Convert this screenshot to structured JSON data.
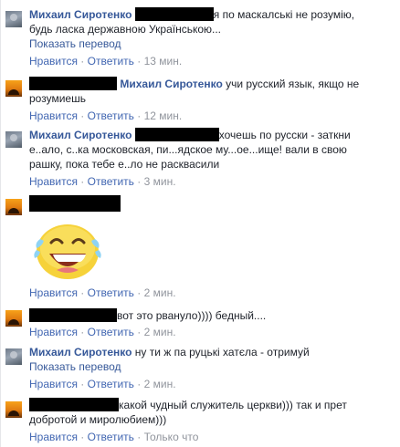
{
  "comments": [
    {
      "author": "Михаил Сиротенко",
      "line1": "я по маскалські не розумію,",
      "line2": "будь ласка державною Українською...",
      "see_translation": "Показать перевод",
      "like": "Нравится",
      "reply": "Ответить",
      "dot": "·",
      "time": "13 мин."
    },
    {
      "author": "Михаил Сиротенко",
      "line1": "учи русский язык, якщо не",
      "line2": "розумиешь",
      "like": "Нравится",
      "reply": "Ответить",
      "dot": "·",
      "time": "12 мин."
    },
    {
      "author": "Михаил Сиротенко",
      "line1": "хочешь по русски - заткни",
      "line2": "е..ало, с..ка московская, пи...ядское му...ое...ище! вали в свою",
      "line3": "рашку, пока тебе е..ло не расквасили",
      "like": "Нравится",
      "reply": "Ответить",
      "dot": "·",
      "time": "3 мин."
    },
    {
      "like": "Нравится",
      "reply": "Ответить",
      "dot": "·",
      "time": "2 мин."
    },
    {
      "line1": "вот это рвануло)))) бедный....",
      "like": "Нравится",
      "reply": "Ответить",
      "dot": "·",
      "time": "2 мин."
    },
    {
      "author": "Михаил Сиротенко",
      "line1": "ну ти ж па руцькі хатєла - отримуй",
      "see_translation": "Показать перевод",
      "like": "Нравится",
      "reply": "Ответить",
      "dot": "·",
      "time": "2 мин."
    },
    {
      "line1": "какой чудный служитель церкви))) так и прет",
      "line2": "добротой и миролюбием)))",
      "like": "Нравится",
      "reply": "Ответить",
      "dot": "·",
      "time": "Только что"
    }
  ],
  "colors": {
    "name": "#365899",
    "link": "#4267b2",
    "meta": "#90949c",
    "text": "#1d2129",
    "redaction": "#000000"
  },
  "icons": {
    "sticker": "laughing-emoji-sticker"
  }
}
